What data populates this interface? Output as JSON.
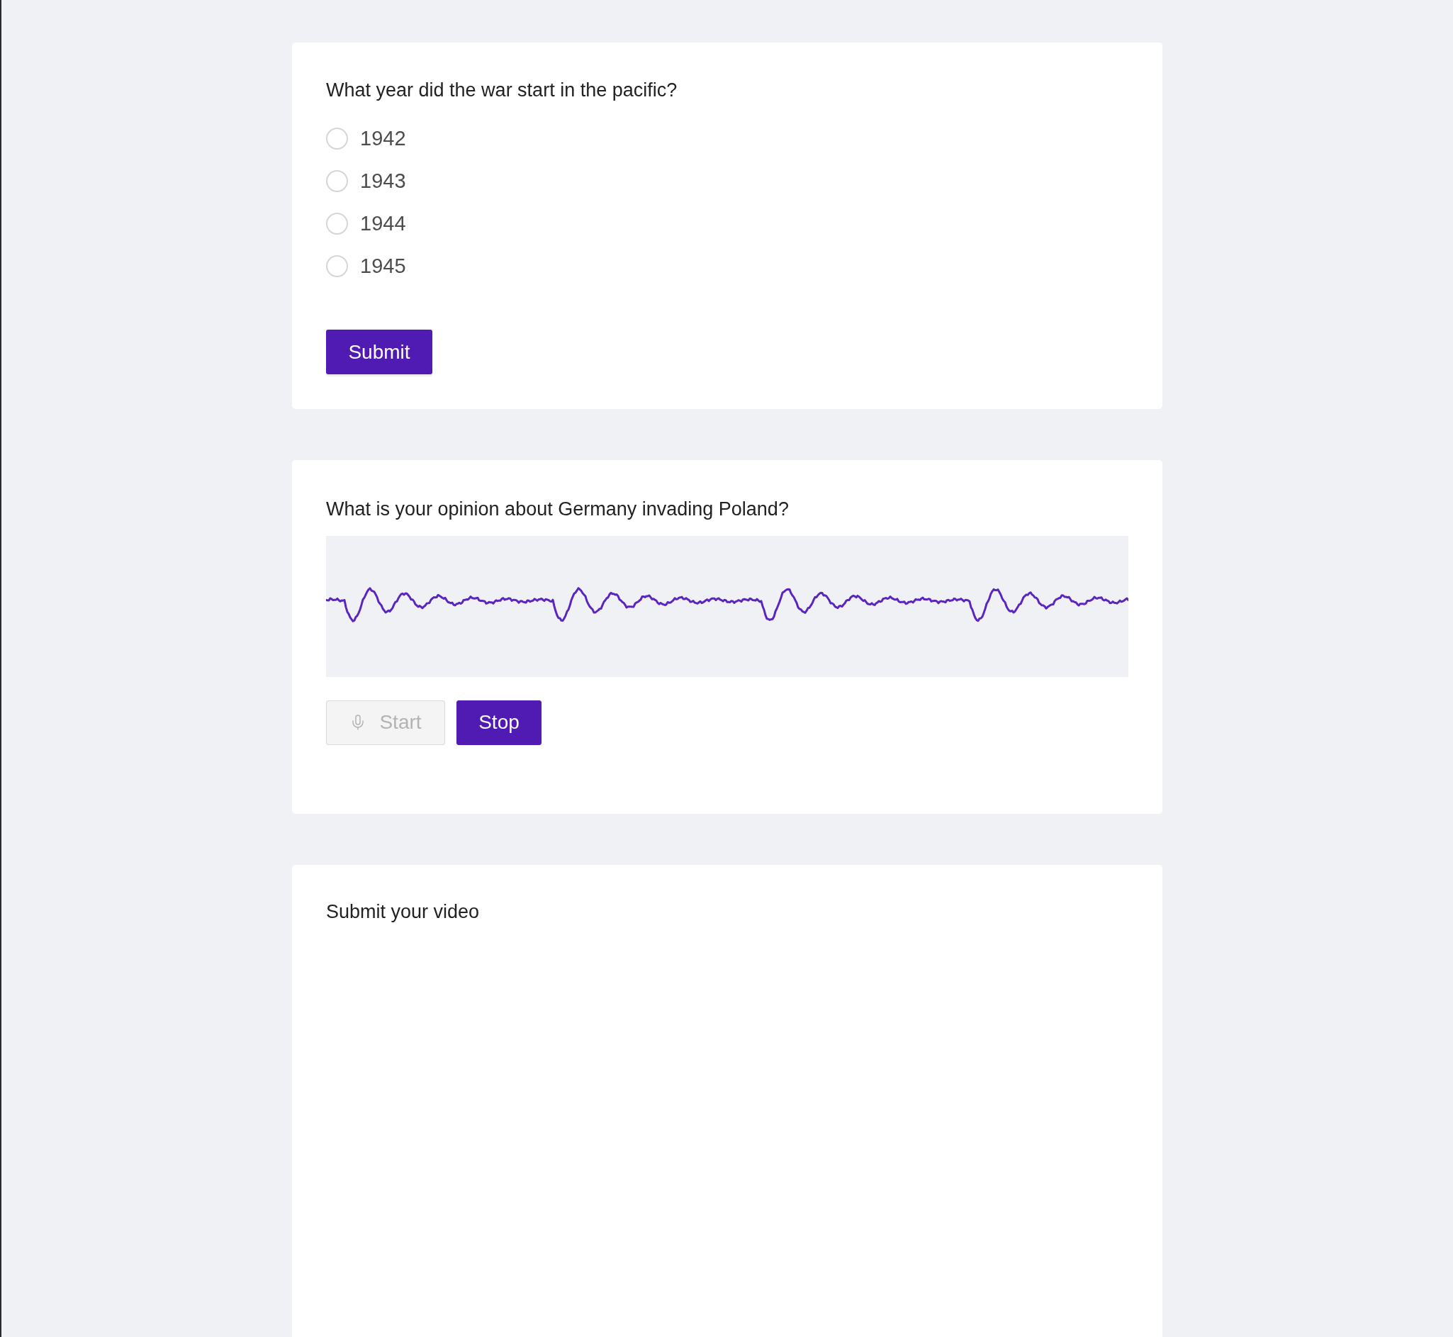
{
  "questions": [
    {
      "kind": "choice",
      "prompt": "What year did the war start in the pacific?",
      "options": [
        {
          "label": "1942",
          "selected": false
        },
        {
          "label": "1943",
          "selected": false
        },
        {
          "label": "1944",
          "selected": false
        },
        {
          "label": "1945",
          "selected": false
        }
      ],
      "submit_button": "Submit"
    },
    {
      "kind": "audio",
      "prompt": "What is your opinion about Germany invading Poland?",
      "start_button": {
        "label": "Start",
        "disabled": true
      },
      "stop_button": {
        "label": "Stop",
        "disabled": false
      }
    },
    {
      "kind": "video",
      "prompt": "Submit your video"
    }
  ]
}
